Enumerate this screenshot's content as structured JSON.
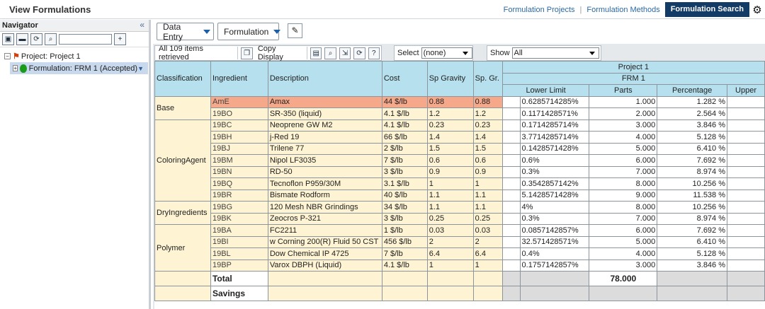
{
  "app_title": "View Formulations",
  "top_links": [
    "Formulation Projects",
    "Formulation Methods"
  ],
  "top_active": "Formulation Search",
  "navigator": {
    "title": "Navigator",
    "collapse": "«",
    "project": "Project: Project 1",
    "formulation": "Formulation: FRM 1 (Accepted)"
  },
  "toolbar": {
    "data_entry": "Data Entry",
    "formulation": "Formulation",
    "items_retrieved": "All 109 items retrieved",
    "copy_display": "Copy Display",
    "select_label": "Select",
    "select_value": "(none)",
    "show_label": "Show",
    "show_value": "All"
  },
  "grid": {
    "headers": {
      "classification": "Classification",
      "ingredient": "Ingredient",
      "description": "Description",
      "cost": "Cost",
      "sp_gravity": "Sp Gravity",
      "sp_gr": "Sp. Gr.",
      "project": "Project 1",
      "formulation": "FRM 1",
      "lower_limit": "Lower Limit",
      "parts": "Parts",
      "percentage": "Percentage",
      "upper": "Upper"
    },
    "groups": [
      {
        "name": "Base",
        "rows": [
          {
            "ingredient": "AmE",
            "description": "Amax",
            "cost": "44 $/lb",
            "sp_gravity": "0.88",
            "sp_gr": "0.88",
            "lower": "0.6285714285",
            "parts": "1.000",
            "pct": "1.282",
            "selected": true
          },
          {
            "ingredient": "19BO",
            "description": "SR-350 (liquid)",
            "cost": "4.1 $/lb",
            "sp_gravity": "1.2",
            "sp_gr": "1.2",
            "lower": "0.1171428571",
            "parts": "2.000",
            "pct": "2.564"
          }
        ]
      },
      {
        "name": "ColoringAgent",
        "rows": [
          {
            "ingredient": "19BC",
            "description": "Neoprene GW M2",
            "cost": "4.1 $/lb",
            "sp_gravity": "0.23",
            "sp_gr": "0.23",
            "lower": "0.1714285714",
            "parts": "3.000",
            "pct": "3.846"
          },
          {
            "ingredient": "19BH",
            "description": "j-Red 19",
            "cost": "66 $/lb",
            "sp_gravity": "1.4",
            "sp_gr": "1.4",
            "lower": "3.7714285714",
            "parts": "4.000",
            "pct": "5.128"
          },
          {
            "ingredient": "19BJ",
            "description": "Trilene 77",
            "cost": "2 $/lb",
            "sp_gravity": "1.5",
            "sp_gr": "1.5",
            "lower": "0.1428571428",
            "parts": "5.000",
            "pct": "6.410"
          },
          {
            "ingredient": "19BM",
            "description": "Nipol LF3035",
            "cost": "7 $/lb",
            "sp_gravity": "0.6",
            "sp_gr": "0.6",
            "lower": "0.6",
            "parts": "6.000",
            "pct": "7.692"
          },
          {
            "ingredient": "19BN",
            "description": "RD-50",
            "cost": "3 $/lb",
            "sp_gravity": "0.9",
            "sp_gr": "0.9",
            "lower": "0.3",
            "parts": "7.000",
            "pct": "8.974"
          },
          {
            "ingredient": "19BQ",
            "description": "Tecnoflon P959/30M",
            "cost": "3.1 $/lb",
            "sp_gravity": "1",
            "sp_gr": "1",
            "lower": "0.3542857142",
            "parts": "8.000",
            "pct": "10.256"
          },
          {
            "ingredient": "19BR",
            "description": "Bismate Rodform",
            "cost": "40 $/lb",
            "sp_gravity": "1.1",
            "sp_gr": "1.1",
            "lower": "5.1428571428",
            "parts": "9.000",
            "pct": "11.538"
          }
        ]
      },
      {
        "name": "DryIngredients",
        "rows": [
          {
            "ingredient": "19BG",
            "description": "120 Mesh NBR Grindings",
            "cost": "34 $/lb",
            "sp_gravity": "1.1",
            "sp_gr": "1.1",
            "lower": "4",
            "parts": "8.000",
            "pct": "10.256"
          },
          {
            "ingredient": "19BK",
            "description": "Zeocros P-321",
            "cost": "3 $/lb",
            "sp_gravity": "0.25",
            "sp_gr": "0.25",
            "lower": "0.3",
            "parts": "7.000",
            "pct": "8.974"
          }
        ]
      },
      {
        "name": "Polymer",
        "rows": [
          {
            "ingredient": "19BA",
            "description": "FC2211",
            "cost": "1 $/lb",
            "sp_gravity": "0.03",
            "sp_gr": "0.03",
            "lower": "0.0857142857",
            "parts": "6.000",
            "pct": "7.692"
          },
          {
            "ingredient": "19BI",
            "description": "w Corning 200(R) Fluid 50 CST",
            "cost": "456 $/lb",
            "sp_gravity": "2",
            "sp_gr": "2",
            "lower": "32.571428571",
            "parts": "5.000",
            "pct": "6.410"
          },
          {
            "ingredient": "19BL",
            "description": "Dow Chemical IP 4725",
            "cost": "7 $/lb",
            "sp_gravity": "6.4",
            "sp_gr": "6.4",
            "lower": "0.4",
            "parts": "4.000",
            "pct": "5.128"
          },
          {
            "ingredient": "19BP",
            "description": "Varox DBPH (Liquid)",
            "cost": "4.1 $/lb",
            "sp_gravity": "1",
            "sp_gr": "1",
            "lower": "0.1757142857",
            "parts": "3.000",
            "pct": "3.846"
          }
        ]
      }
    ],
    "unit_pct": "%",
    "total_label": "Total",
    "total_parts": "78.000",
    "savings_label": "Savings"
  }
}
